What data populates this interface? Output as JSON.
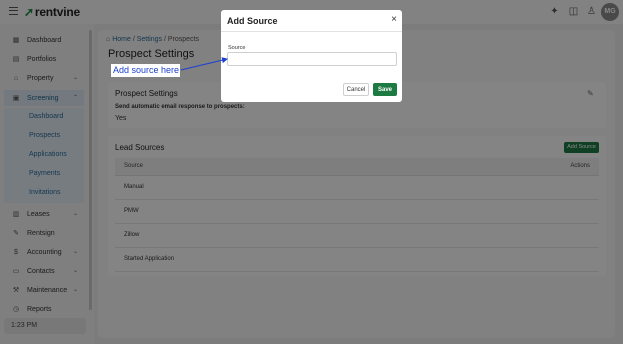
{
  "topbar": {
    "logo_text": "rentvine",
    "avatar_initials": "MG",
    "icons": [
      "menu-icon",
      "sparkle-icon",
      "notification-icon",
      "user-icon"
    ]
  },
  "sidebar": {
    "items": [
      {
        "label": "Dashboard",
        "icon": "dashboard-icon"
      },
      {
        "label": "Portfolios",
        "icon": "portfolio-icon"
      },
      {
        "label": "Property",
        "icon": "property-icon"
      },
      {
        "label": "Screening",
        "icon": "screening-icon"
      },
      {
        "label": "Leases",
        "icon": "lease-icon"
      },
      {
        "label": "Rentsign",
        "icon": "rentsign-icon"
      },
      {
        "label": "Accounting",
        "icon": "dollar-icon"
      },
      {
        "label": "Contacts",
        "icon": "contacts-icon"
      },
      {
        "label": "Maintenance",
        "icon": "wrench-icon"
      },
      {
        "label": "Reports",
        "icon": "reports-icon"
      }
    ],
    "screening_subitems": [
      "Dashboard",
      "Prospects",
      "Applications",
      "Payments",
      "Invitations"
    ],
    "time": "1:23 PM"
  },
  "breadcrumb": {
    "home": "Home",
    "sep": "/",
    "settings": "Settings",
    "current": "Prospects"
  },
  "page_title": "Prospect Settings",
  "prospect_card": {
    "title": "Prospect Settings",
    "setting_label": "Send automatic email response to prospects:",
    "setting_value": "Yes"
  },
  "lead_sources": {
    "title": "Lead Sources",
    "add_button": "Add Source",
    "columns": [
      "Source",
      "Actions"
    ],
    "rows": [
      "Manual",
      "PMW",
      "Zillow",
      "Started Application"
    ]
  },
  "modal": {
    "title": "Add Source",
    "close": "×",
    "field_label": "Source",
    "field_value": "",
    "cancel": "Cancel",
    "save": "Save"
  },
  "annotation": {
    "text": "Add source here",
    "color": "#1a3fd1"
  }
}
